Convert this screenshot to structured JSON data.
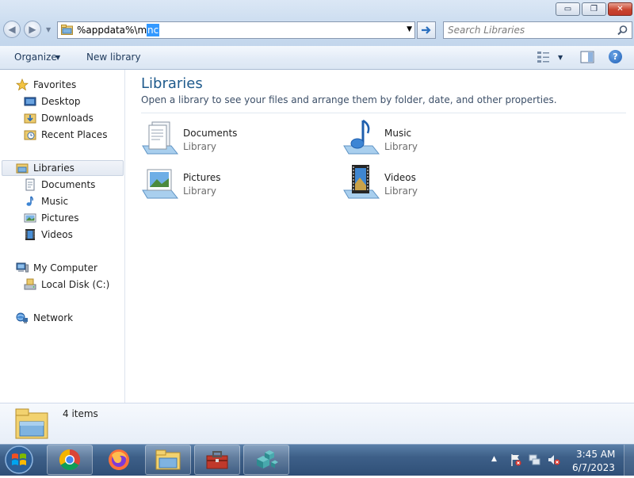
{
  "window": {
    "minimize_label": "▭",
    "maximize_label": "❐",
    "close_label": "✕"
  },
  "address": {
    "path_prefix": "%appdata%\\m",
    "path_selected": "nc"
  },
  "search": {
    "placeholder": "Search Libraries"
  },
  "toolbar": {
    "organize_label": "Organize",
    "new_library_label": "New library"
  },
  "nav": {
    "favorites": "Favorites",
    "desktop": "Desktop",
    "downloads": "Downloads",
    "recent_places": "Recent Places",
    "libraries": "Libraries",
    "documents": "Documents",
    "music": "Music",
    "pictures": "Pictures",
    "videos": "Videos",
    "my_computer": "My Computer",
    "local_disk": "Local Disk (C:)",
    "network": "Network"
  },
  "content": {
    "title": "Libraries",
    "description": "Open a library to see your files and arrange them by folder, date, and other properties.",
    "libraries": [
      {
        "name": "Documents",
        "type": "Library",
        "icon": "documents-library-icon"
      },
      {
        "name": "Music",
        "type": "Library",
        "icon": "music-library-icon"
      },
      {
        "name": "Pictures",
        "type": "Library",
        "icon": "pictures-library-icon"
      },
      {
        "name": "Videos",
        "type": "Library",
        "icon": "videos-library-icon"
      }
    ]
  },
  "details": {
    "count": "4 items"
  },
  "taskbar": {
    "apps": [
      "chrome-icon",
      "firefox-icon",
      "file-explorer-icon",
      "toolbox-icon",
      "app-cubes-icon"
    ],
    "time": "3:45 AM",
    "date": "6/7/2023"
  },
  "colors": {
    "accent_title": "#1e5a8c",
    "selection": "#3399ff"
  }
}
